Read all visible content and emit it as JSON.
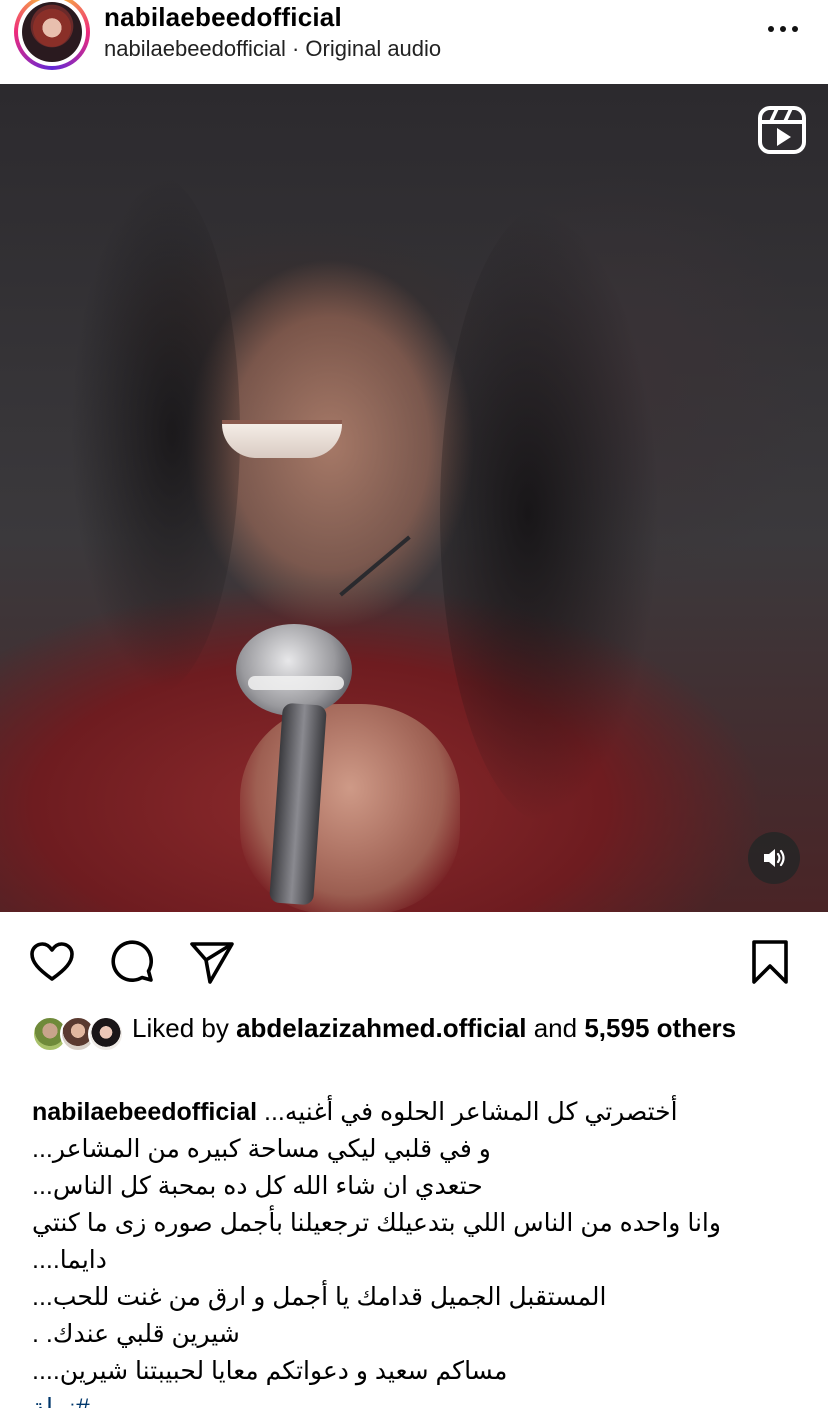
{
  "header": {
    "username": "nabilaebeedofficial",
    "subtitle": "nabilaebeedofficial · Original audio",
    "more_icon": "more-horizontal-icon"
  },
  "media": {
    "type_icon": "reels-icon",
    "audio_icon": "speaker-icon"
  },
  "actions": {
    "like_icon": "heart-icon",
    "comment_icon": "comment-icon",
    "share_icon": "share-icon",
    "save_icon": "bookmark-icon"
  },
  "likes": {
    "prefix": "Liked by",
    "liker": "abdelazizahmed.official",
    "conjunction": "and",
    "count": "5,595",
    "suffix": "others"
  },
  "caption": {
    "username": "nabilaebeedofficial",
    "lines": [
      "أختصرتي كل المشاعر  الحلوه في أغنيه...",
      "و في قلبي ليكي مساحة كبيره من المشاعر...",
      "حتعدي ان شاء الله كل ده  بمحبة كل الناس...",
      "وانا واحده من الناس اللي بتدعيلك ترجعيلنا بأجمل صوره زى ما كنتي",
      "دايما....",
      "المستقبل  الجميل  قدامك يا أجمل و ارق من غنت للحب...",
      "شيرين قلبي عندك. .",
      "مساكم سعيد و دعواتكم معايا لحبيبتنا شيرين....",
      "#نبيلة"
    ]
  },
  "colors": {
    "link": "#00376b",
    "text": "#000000"
  }
}
